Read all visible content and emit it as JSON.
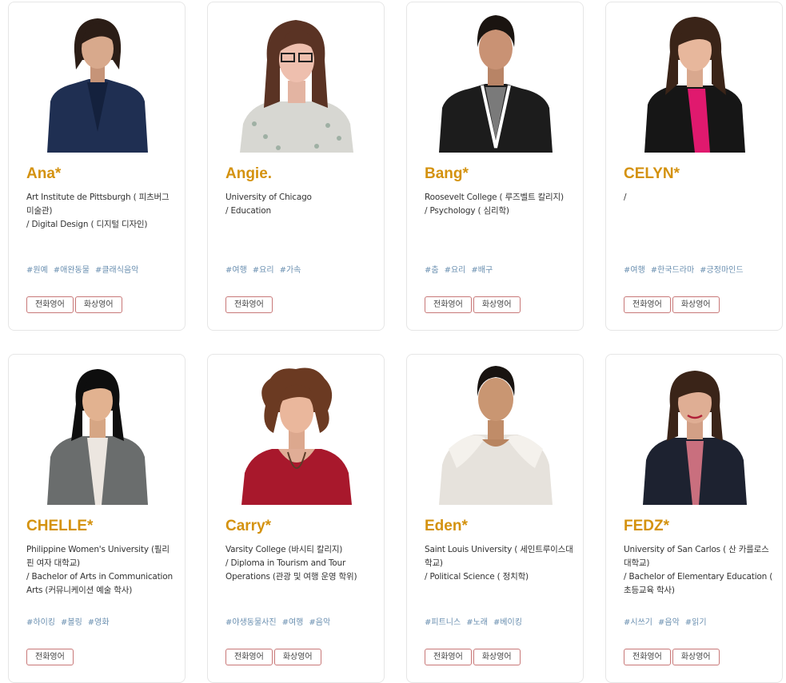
{
  "tutors": [
    {
      "name": "Ana*",
      "school": "Art Institute de Pittsburgh ( 피츠버그 미술관)",
      "major": "/ Digital Design ( 디지털 디자인)",
      "tags": [
        "#원예",
        "#애완동물",
        "#클래식음악"
      ],
      "buttons": [
        "전화영어",
        "화상영어"
      ]
    },
    {
      "name": "Angie.",
      "school": "University of Chicago",
      "major": "/ Education",
      "tags": [
        "#여행",
        "#요리",
        "#가속"
      ],
      "buttons": [
        "전화영어"
      ]
    },
    {
      "name": "Bang*",
      "school": "Roosevelt College ( 루즈벨트 칼리지)",
      "major": "/ Psychology ( 심리학)",
      "tags": [
        "#춤",
        "#요리",
        "#배구"
      ],
      "buttons": [
        "전화영어",
        "화상영어"
      ]
    },
    {
      "name": "CELYN*",
      "school": "",
      "major": "/",
      "tags": [
        "#여행",
        "#한국드라마",
        "#긍정마인드"
      ],
      "buttons": [
        "전화영어",
        "화상영어"
      ]
    },
    {
      "name": "CHELLE*",
      "school": "Philippine Women's University (필리핀 여자 대학교)",
      "major": "/ Bachelor of Arts in Communication Arts (커뮤니케이션 예술 학사)",
      "tags": [
        "#하이킹",
        "#볼링",
        "#영화"
      ],
      "buttons": [
        "전화영어"
      ]
    },
    {
      "name": "Carry*",
      "school": "Varsity College (바시티 칼리지)",
      "major": "/ Diploma in Tourism and Tour Operations (관광 및 여행 운영 학위)",
      "tags": [
        "#야생동물사진",
        "#여행",
        "#음악"
      ],
      "buttons": [
        "전화영어",
        "화상영어"
      ]
    },
    {
      "name": "Eden*",
      "school": "Saint Louis University ( 세인트루이스대학교)",
      "major": "/ Political Science ( 정치학)",
      "tags": [
        "#피트니스",
        "#노래",
        "#베이킹"
      ],
      "buttons": [
        "전화영어",
        "화상영어"
      ]
    },
    {
      "name": "FEDZ*",
      "school": "University of San Carlos ( 산 카를로스 대학교)",
      "major": "/ Bachelor of Elementary Education ( 초등교육 학사)",
      "tags": [
        "#시쓰기",
        "#음악",
        "#읽기"
      ],
      "buttons": [
        "전화영어",
        "화상영어"
      ]
    }
  ],
  "colors": {
    "name": "#d4920f",
    "tag": "#6a8fb0",
    "button_border": "#c87878"
  }
}
